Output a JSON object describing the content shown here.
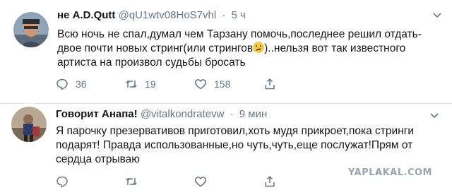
{
  "tweets": [
    {
      "name": "не A.D.Qutt",
      "handle": "@qU1wtv08HoS7vhl",
      "separator": "·",
      "time": "5 ч",
      "text_before": "Всю ночь не спал,думал чем Тарзану помочь,последнее решил отдать- двое почти новых стринг(или стрингов",
      "emoji": "thinking-face-emoji",
      "text_after": ")..нельзя вот так известного артиста на произвол судьбы бросать",
      "actions": {
        "reply_count": "36",
        "retweet_count": "19",
        "like_count": "158"
      }
    },
    {
      "name": "Говорит Анапа!",
      "handle": "@vitalkondratevw",
      "separator": "·",
      "time": "9 мин",
      "text": "Я парочку презервативов приготовил,хоть мудя прикроет,пока стринги подарят! Правда использованные,но чуть,чуть,еще послужат!Прям от сердца отрываю",
      "actions": {
        "reply_count": "",
        "retweet_count": "",
        "like_count": ""
      }
    }
  ],
  "icons": [
    "reply-icon",
    "retweet-icon",
    "like-icon",
    "share-icon",
    "chevron-down-icon"
  ],
  "colors": {
    "text": "#14171a",
    "secondary": "#657786",
    "divider": "#e6ecf0"
  },
  "watermark": "YAPLAKAL.COM"
}
